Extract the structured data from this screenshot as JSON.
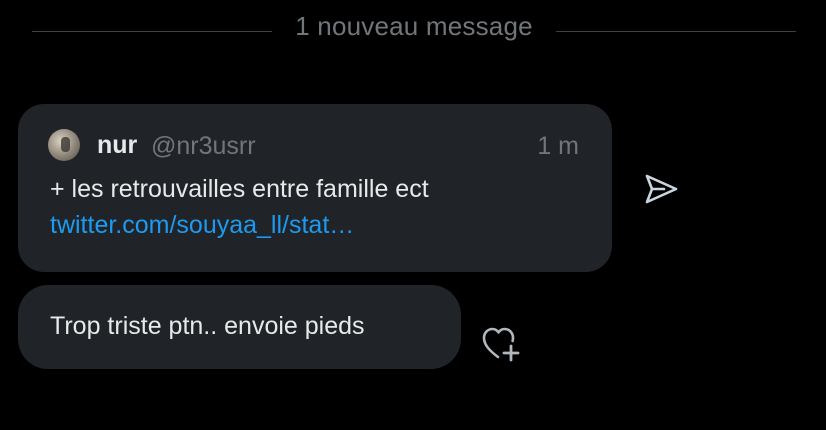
{
  "divider": {
    "label": "1 nouveau message"
  },
  "quoted_tweet": {
    "author_name": "nur",
    "author_handle": "@nr3usrr",
    "time": "1 m",
    "text": "+ les retrouvailles entre famille ect",
    "link": "twitter.com/souyaa_ll/stat…",
    "avatar_icon": "user-avatar",
    "action_icon": "send-icon"
  },
  "message": {
    "text": "Trop triste ptn.. envoie pieds",
    "reaction_icon": "heart-plus-icon"
  },
  "colors": {
    "background": "#000000",
    "bubble": "#202327",
    "text": "#e7e9ea",
    "muted": "#71767b",
    "link": "#1d9bf0"
  }
}
